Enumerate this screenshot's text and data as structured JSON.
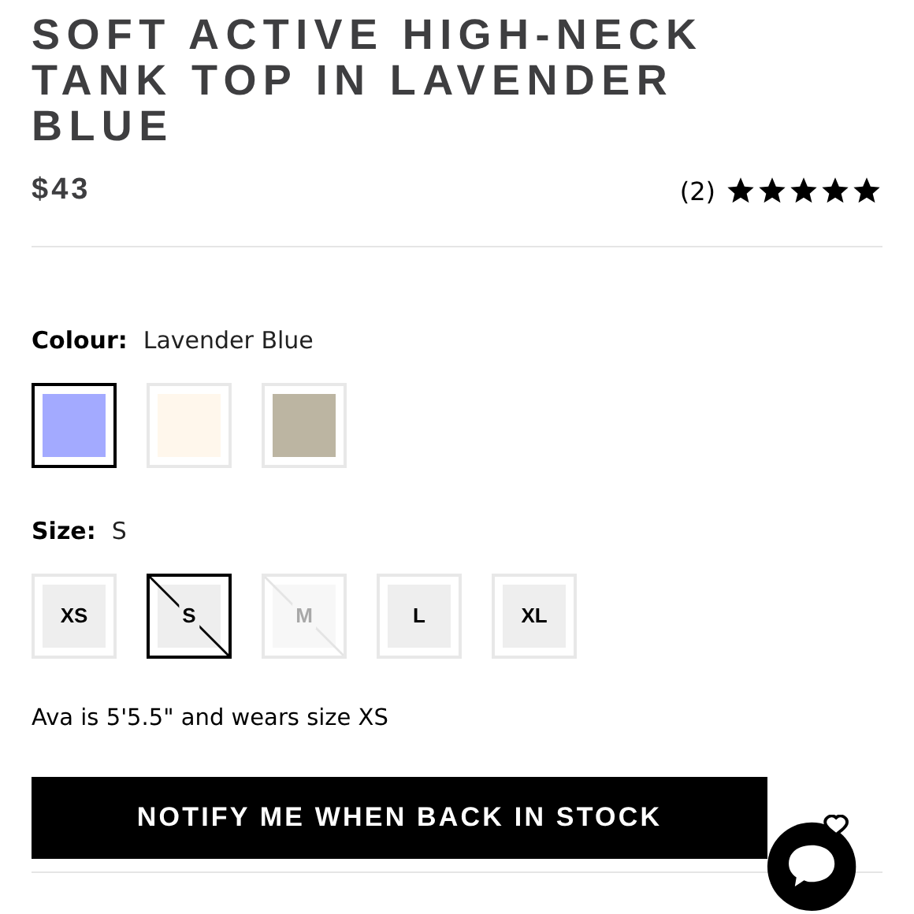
{
  "product": {
    "title": "SOFT ACTIVE HIGH-NECK TANK TOP IN LAVENDER BLUE",
    "price": "$43",
    "review_count": "(2)",
    "stars": 5
  },
  "colour": {
    "label": "Colour:",
    "value": "Lavender Blue",
    "swatches": [
      {
        "color": "#a3aaff",
        "selected": true
      },
      {
        "color": "#fff7ec",
        "selected": false
      },
      {
        "color": "#bcb5a2",
        "selected": false
      }
    ]
  },
  "size": {
    "label": "Size:",
    "value": "S",
    "options": [
      {
        "label": "XS",
        "selected": false,
        "sold_out": false
      },
      {
        "label": "S",
        "selected": true,
        "sold_out": true
      },
      {
        "label": "M",
        "selected": false,
        "sold_out": true
      },
      {
        "label": "L",
        "selected": false,
        "sold_out": false
      },
      {
        "label": "XL",
        "selected": false,
        "sold_out": false
      }
    ]
  },
  "model_note": "Ava is 5'5.5\" and wears size XS",
  "notify_button": "NOTIFY ME WHEN BACK IN STOCK"
}
